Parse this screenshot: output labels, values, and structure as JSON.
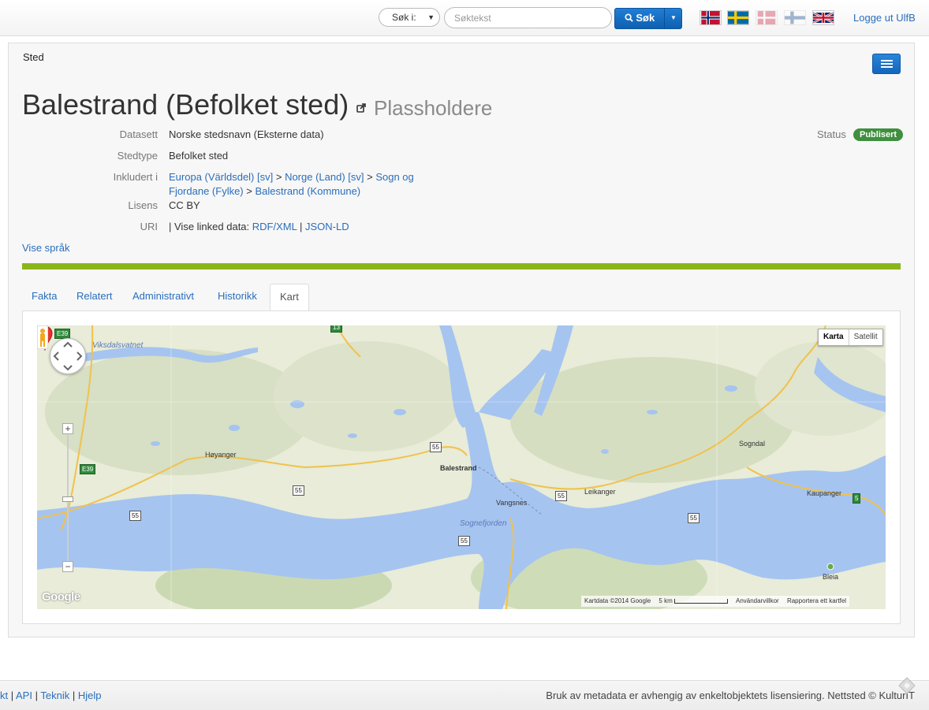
{
  "navbar": {
    "search_type_label": "Søk i:",
    "search_placeholder": "Søktekst",
    "search_button": "Søk",
    "flags": [
      "norwegian-flag-icon",
      "swedish-flag-icon",
      "danish-flag-icon",
      "finnish-flag-icon",
      "uk-flag-icon"
    ],
    "logout": "Logge ut UlfB"
  },
  "panel": {
    "type_label": "Sted",
    "title": "Balestrand (Befolket sted)",
    "subtitle": "Plassholdere",
    "status_label": "Status",
    "status_value": "Publisert",
    "status_color": "#3f8f3f",
    "fields": {
      "dataset_label": "Datasett",
      "dataset_value": "Norske stedsnavn (Eksterne data)",
      "stedtype_label": "Stedtype",
      "stedtype_value": "Befolket sted",
      "included_label": "Inkludert i",
      "included_path": [
        "Europa (Världsdel) [sv]",
        "Norge (Land) [sv]",
        "Sogn og Fjordane (Fylke)",
        "Balestrand (Kommune)"
      ],
      "license_label": "Lisens",
      "license_value": "CC BY",
      "uri_label": "URI",
      "uri_prefix": "| Vise linked data:",
      "uri_rdf": "RDF/XML",
      "uri_jsonld": "JSON-LD"
    },
    "show_languages": "Vise språk",
    "accent_color": "#8ab61b"
  },
  "tabs": [
    {
      "label": "Fakta",
      "active": false
    },
    {
      "label": "Relatert",
      "active": false
    },
    {
      "label": "Administrativt",
      "active": false
    },
    {
      "label": "Historikk",
      "active": false
    },
    {
      "label": "Kart",
      "active": true
    }
  ],
  "map": {
    "type_buttons": [
      "Karta",
      "Satellit"
    ],
    "places": [
      "Balestrand",
      "Høyanger",
      "Vangsnes",
      "Leikanger",
      "Sogndal",
      "Kaupanger",
      "Bleia"
    ],
    "water_labels": [
      "Viksdalsvatnet",
      "Sognefjorden"
    ],
    "roads": [
      "E39",
      "E39",
      "55",
      "55",
      "55",
      "55",
      "55",
      "55",
      "5",
      "13"
    ],
    "google_logo": "Google",
    "attribution": {
      "data": "Kartdata ©2014 Google",
      "scale": "5 km",
      "terms": "Användarvillkor",
      "report": "Rapportera ett kartfel"
    }
  },
  "footer": {
    "links": [
      "kt",
      "API",
      "Teknik",
      "Hjelp"
    ],
    "text": "Bruk av metadata er avhengig av enkeltobjektets lisensiering. Nettsted © KulturIT"
  }
}
